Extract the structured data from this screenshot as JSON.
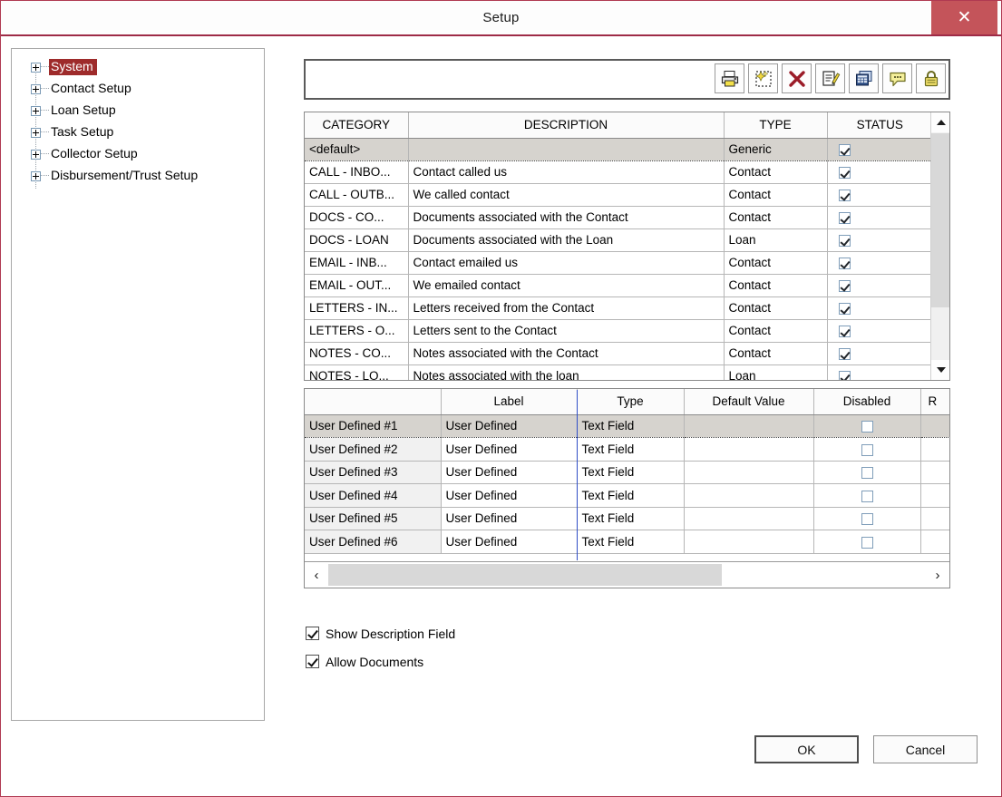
{
  "window": {
    "title": "Setup",
    "close_label": "✕",
    "accent_color": "#9e2b47"
  },
  "tree": {
    "items": [
      {
        "label": "System",
        "selected": true
      },
      {
        "label": "Contact Setup",
        "selected": false
      },
      {
        "label": "Loan Setup",
        "selected": false
      },
      {
        "label": "Task Setup",
        "selected": false
      },
      {
        "label": "Collector Setup",
        "selected": false
      },
      {
        "label": "Disbursement/Trust Setup",
        "selected": false
      }
    ],
    "selected_color": "#9e2b2b"
  },
  "search": {
    "value": "",
    "placeholder": ""
  },
  "toolbar": {
    "buttons": [
      {
        "icon": "printer-icon",
        "title": "Print"
      },
      {
        "icon": "new-item-icon",
        "title": "New"
      },
      {
        "icon": "delete-x-icon",
        "title": "Delete"
      },
      {
        "icon": "edit-pencil-icon",
        "title": "Edit"
      },
      {
        "icon": "grid-table-icon",
        "title": "Grid"
      },
      {
        "icon": "comment-bubble-icon",
        "title": "Comment"
      },
      {
        "icon": "lock-icon",
        "title": "Lock"
      }
    ]
  },
  "category_grid": {
    "columns": [
      "CATEGORY",
      "DESCRIPTION",
      "TYPE",
      "STATUS"
    ],
    "rows": [
      {
        "category": "<default>",
        "description": "",
        "type": "Generic",
        "status": true,
        "selected": true
      },
      {
        "category": "CALL - INBO...",
        "description": "Contact called us",
        "type": "Contact",
        "status": true,
        "selected": false
      },
      {
        "category": "CALL - OUTB...",
        "description": "We called contact",
        "type": "Contact",
        "status": true,
        "selected": false
      },
      {
        "category": "DOCS - CO...",
        "description": "Documents associated with the Contact",
        "type": "Contact",
        "status": true,
        "selected": false
      },
      {
        "category": "DOCS - LOAN",
        "description": "Documents associated with the Loan",
        "type": "Loan",
        "status": true,
        "selected": false
      },
      {
        "category": "EMAIL - INB...",
        "description": "Contact emailed us",
        "type": "Contact",
        "status": true,
        "selected": false
      },
      {
        "category": "EMAIL - OUT...",
        "description": "We emailed contact",
        "type": "Contact",
        "status": true,
        "selected": false
      },
      {
        "category": "LETTERS - IN...",
        "description": "Letters received from the Contact",
        "type": "Contact",
        "status": true,
        "selected": false
      },
      {
        "category": "LETTERS - O...",
        "description": "Letters sent to the Contact",
        "type": "Contact",
        "status": true,
        "selected": false
      },
      {
        "category": "NOTES - CO...",
        "description": "Notes associated with the Contact",
        "type": "Contact",
        "status": true,
        "selected": false
      },
      {
        "category": "NOTES - LO...",
        "description": "Notes associated with the loan",
        "type": "Loan",
        "status": true,
        "selected": false
      }
    ],
    "scroll": {
      "up_arrow": "∧",
      "down_arrow": "∨"
    }
  },
  "fields_grid": {
    "columns": [
      "",
      "Label",
      "Type",
      "Default Value",
      "Disabled",
      "R"
    ],
    "rows": [
      {
        "name": "User Defined #1",
        "label": "User Defined",
        "type": "Text Field",
        "default_value": "",
        "disabled": false,
        "selected": true
      },
      {
        "name": "User Defined #2",
        "label": "User Defined",
        "type": "Text Field",
        "default_value": "",
        "disabled": false,
        "selected": false
      },
      {
        "name": "User Defined #3",
        "label": "User Defined",
        "type": "Text Field",
        "default_value": "",
        "disabled": false,
        "selected": false
      },
      {
        "name": "User Defined #4",
        "label": "User Defined",
        "type": "Text Field",
        "default_value": "",
        "disabled": false,
        "selected": false
      },
      {
        "name": "User Defined #5",
        "label": "User Defined",
        "type": "Text Field",
        "default_value": "",
        "disabled": false,
        "selected": false
      },
      {
        "name": "User Defined #6",
        "label": "User Defined",
        "type": "Text Field",
        "default_value": "",
        "disabled": false,
        "selected": false
      }
    ],
    "scroll": {
      "left_arrow": "‹",
      "right_arrow": "›"
    }
  },
  "options": [
    {
      "label": "Show Description Field",
      "checked": true
    },
    {
      "label": "Allow Documents",
      "checked": true
    }
  ],
  "footer": {
    "ok_label": "OK",
    "cancel_label": "Cancel"
  }
}
